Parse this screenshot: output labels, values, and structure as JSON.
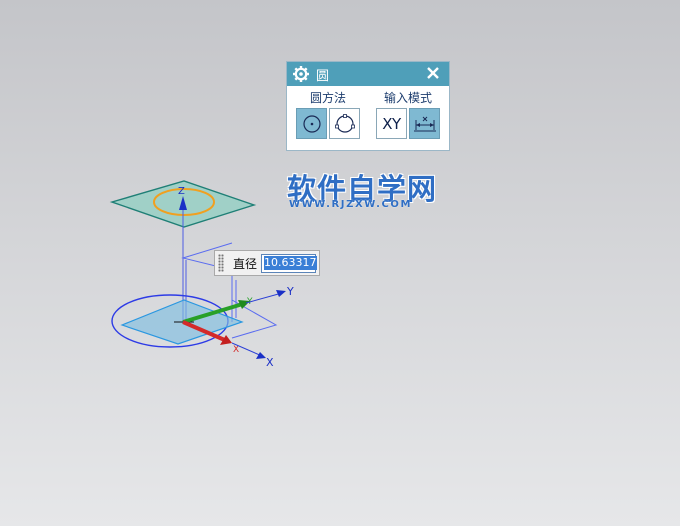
{
  "dialog": {
    "title": "圆",
    "method_label": "圆方法",
    "input_label": "输入模式",
    "xy_label": "XY"
  },
  "dimension": {
    "label": "直径",
    "value": "10.63317"
  },
  "axes": {
    "x": "X",
    "y": "Y",
    "z": "Z",
    "x_small": "X",
    "y_small": "Y"
  },
  "watermark": {
    "cn": "软件自学网",
    "url": "WWW.RJZXW.COM"
  },
  "colors": {
    "title_bar": "#4f9fb9",
    "active_button": "#7fb9d2",
    "plane_fill": "#8fcfc2",
    "x_axis": "#d42a2a",
    "y_axis": "#28a028",
    "z_axis": "#2b3fd6",
    "preview_circle": "#f0a020"
  }
}
